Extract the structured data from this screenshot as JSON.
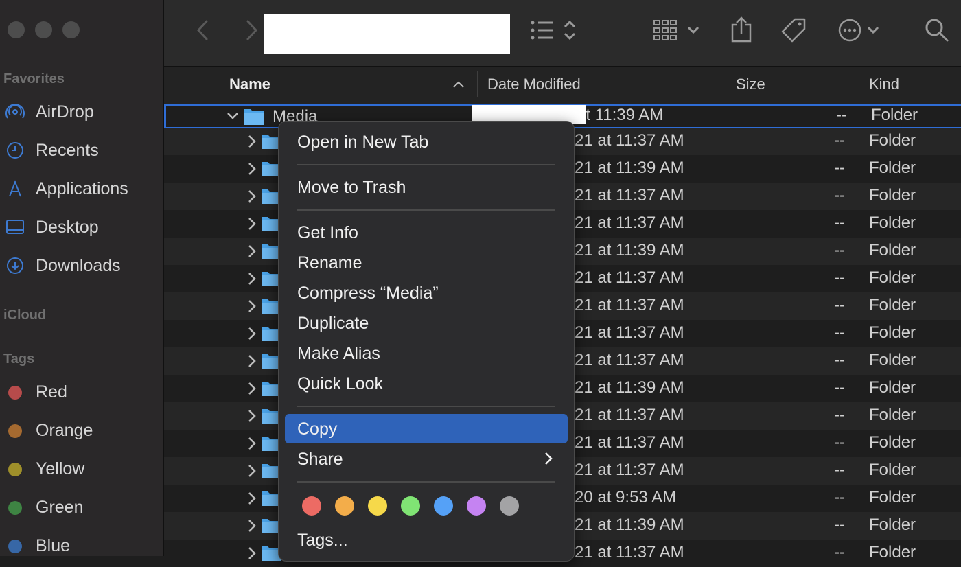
{
  "sidebar": {
    "sections": {
      "favorites": "Favorites",
      "icloud": "iCloud",
      "tags": "Tags"
    },
    "favorites": [
      {
        "label": "AirDrop",
        "icon": "airdrop-icon"
      },
      {
        "label": "Recents",
        "icon": "clock-icon"
      },
      {
        "label": "Applications",
        "icon": "applications-icon"
      },
      {
        "label": "Desktop",
        "icon": "desktop-icon"
      },
      {
        "label": "Downloads",
        "icon": "download-icon"
      }
    ],
    "tags": [
      {
        "label": "Red",
        "color": "#b74b4b"
      },
      {
        "label": "Orange",
        "color": "#a56a30"
      },
      {
        "label": "Yellow",
        "color": "#9e8f2a"
      },
      {
        "label": "Green",
        "color": "#3e8443"
      },
      {
        "label": "Blue",
        "color": "#3767a6"
      }
    ]
  },
  "columns": {
    "name": "Name",
    "date": "Date Modified",
    "size": "Size",
    "kind": "Kind"
  },
  "selected_row": {
    "name": "Media",
    "date": "at 11:39 AM",
    "size": "--",
    "kind": "Folder"
  },
  "rows": [
    {
      "date": "21 at 11:37 AM",
      "size": "--",
      "kind": "Folder"
    },
    {
      "date": "21 at 11:39 AM",
      "size": "--",
      "kind": "Folder"
    },
    {
      "date": "21 at 11:37 AM",
      "size": "--",
      "kind": "Folder"
    },
    {
      "date": "21 at 11:37 AM",
      "size": "--",
      "kind": "Folder"
    },
    {
      "date": "21 at 11:39 AM",
      "size": "--",
      "kind": "Folder"
    },
    {
      "date": "21 at 11:37 AM",
      "size": "--",
      "kind": "Folder"
    },
    {
      "date": "21 at 11:37 AM",
      "size": "--",
      "kind": "Folder"
    },
    {
      "date": "21 at 11:37 AM",
      "size": "--",
      "kind": "Folder"
    },
    {
      "date": "21 at 11:37 AM",
      "size": "--",
      "kind": "Folder"
    },
    {
      "date": "21 at 11:39 AM",
      "size": "--",
      "kind": "Folder"
    },
    {
      "date": "21 at 11:37 AM",
      "size": "--",
      "kind": "Folder"
    },
    {
      "date": "21 at 11:37 AM",
      "size": "--",
      "kind": "Folder"
    },
    {
      "date": "21 at 11:37 AM",
      "size": "--",
      "kind": "Folder"
    },
    {
      "date": "20 at 9:53 AM",
      "size": "--",
      "kind": "Folder"
    },
    {
      "date": "21 at 11:39 AM",
      "size": "--",
      "kind": "Folder"
    },
    {
      "date": "21 at 11:37 AM",
      "size": "--",
      "kind": "Folder"
    }
  ],
  "context_menu": {
    "open_new_tab": "Open in New Tab",
    "move_to_trash": "Move to Trash",
    "get_info": "Get Info",
    "rename": "Rename",
    "compress": "Compress “Media”",
    "duplicate": "Duplicate",
    "make_alias": "Make Alias",
    "quick_look": "Quick Look",
    "copy": "Copy",
    "share": "Share",
    "tags": "Tags...",
    "tag_colors": [
      "#ec6b64",
      "#f3ad4a",
      "#f6d94a",
      "#80e474",
      "#55a1f7",
      "#c583f2",
      "#a3a3a5"
    ],
    "highlight_color": "#2f63b9"
  }
}
